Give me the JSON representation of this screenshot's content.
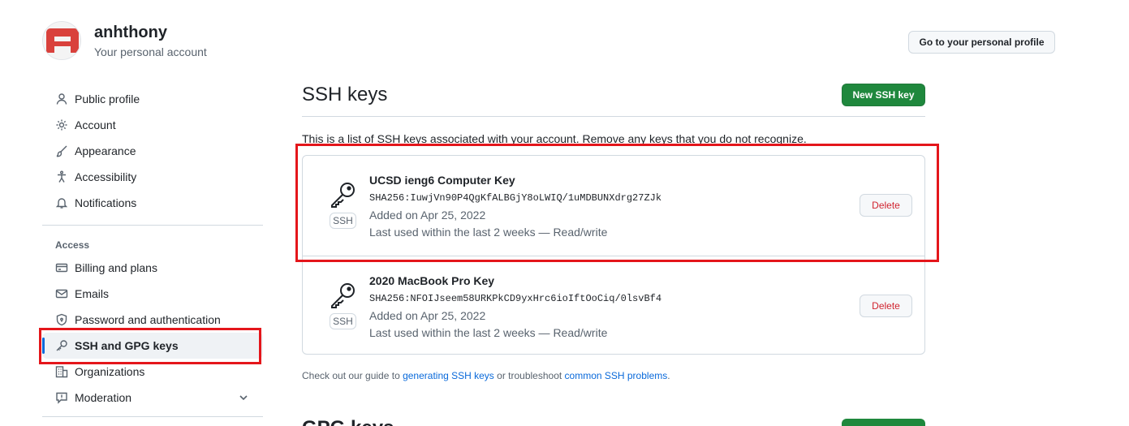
{
  "header": {
    "username": "anhthony",
    "subtitle": "Your personal account",
    "profile_button": "Go to your personal profile"
  },
  "sidebar": {
    "items_top": [
      {
        "label": "Public profile",
        "icon": "person-icon"
      },
      {
        "label": "Account",
        "icon": "gear-icon"
      },
      {
        "label": "Appearance",
        "icon": "paintbrush-icon"
      },
      {
        "label": "Accessibility",
        "icon": "accessibility-icon"
      },
      {
        "label": "Notifications",
        "icon": "bell-icon"
      }
    ],
    "access_heading": "Access",
    "items_access": [
      {
        "label": "Billing and plans",
        "icon": "credit-card-icon"
      },
      {
        "label": "Emails",
        "icon": "mail-icon"
      },
      {
        "label": "Password and authentication",
        "icon": "shield-lock-icon"
      },
      {
        "label": "SSH and GPG keys",
        "icon": "key-icon",
        "active": true
      },
      {
        "label": "Organizations",
        "icon": "organization-icon"
      },
      {
        "label": "Moderation",
        "icon": "report-icon"
      }
    ]
  },
  "main": {
    "title": "SSH keys",
    "new_button": "New SSH key",
    "intro": "This is a list of SSH keys associated with your account. Remove any keys that you do not recognize.",
    "keys": [
      {
        "title": "UCSD ieng6 Computer Key",
        "fingerprint": "SHA256:IuwjVn90P4QgKfALBGjY8oLWIQ/1uMDBUNXdrg27ZJk",
        "added": "Added on Apr 25, 2022",
        "last_used": "Last used within the last 2 weeks — Read/write",
        "type_label": "SSH",
        "delete_label": "Delete"
      },
      {
        "title": "2020 MacBook Pro Key",
        "fingerprint": "SHA256:NFOIJseem58URKPkCD9yxHrc6ioIftOoCiq/0lsvBf4",
        "added": "Added on Apr 25, 2022",
        "last_used": "Last used within the last 2 weeks — Read/write",
        "type_label": "SSH",
        "delete_label": "Delete"
      }
    ],
    "footer": {
      "prefix": "Check out our guide to ",
      "link1": "generating SSH keys",
      "middle": " or troubleshoot ",
      "link2": "common SSH problems",
      "suffix": "."
    },
    "gpg_title": "GPG keys"
  },
  "colors": {
    "accent": "#0969da",
    "primary_button": "#1f883d",
    "danger": "#d1242f",
    "highlight_box": "#e4161b"
  }
}
